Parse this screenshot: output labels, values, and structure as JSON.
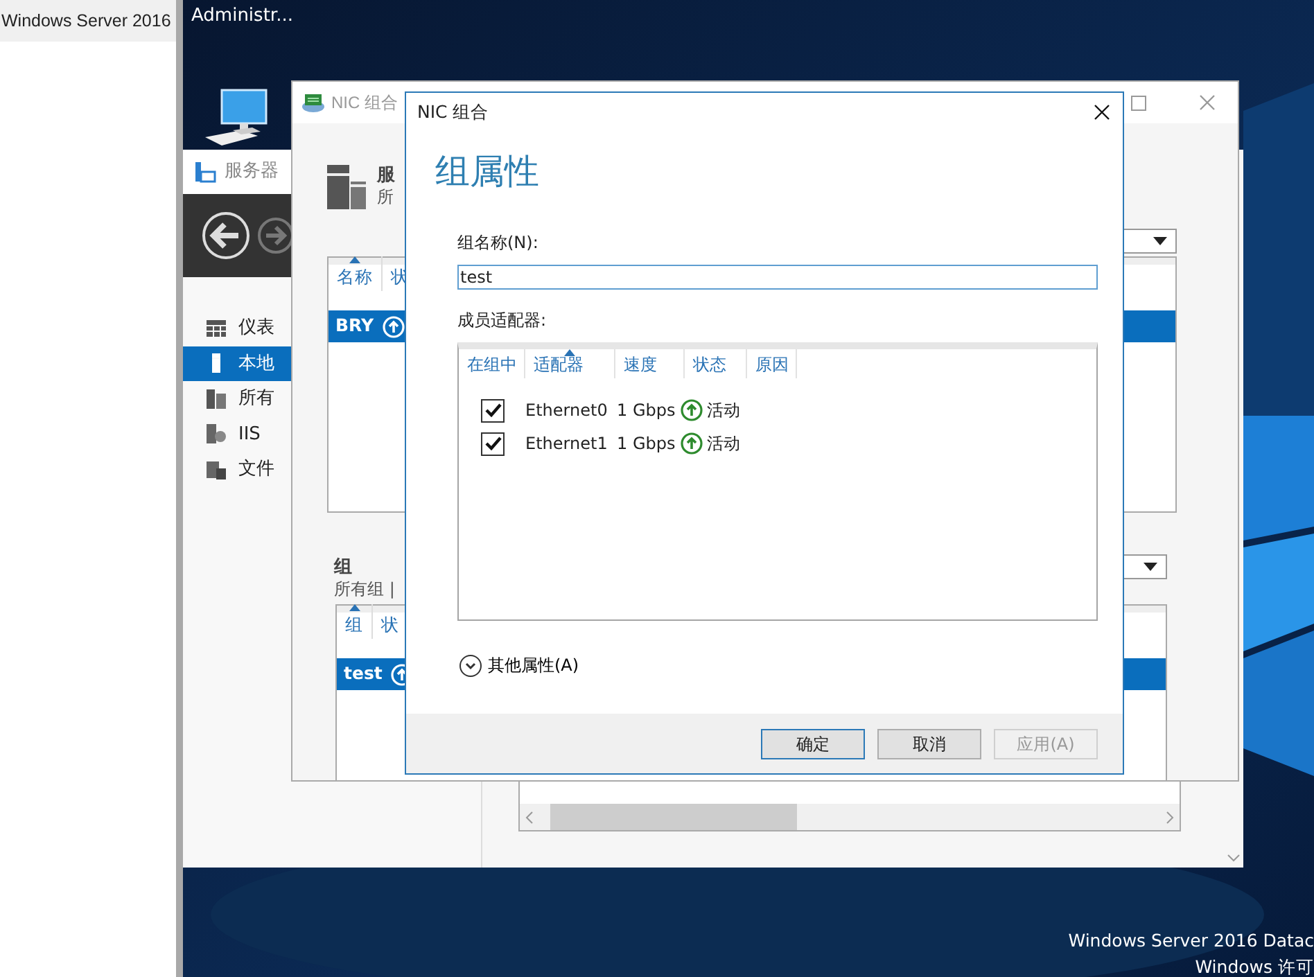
{
  "side_panel": {
    "title": "Windows Server 2016"
  },
  "desktop": {
    "user": "Administr...",
    "edition_lines": [
      "Windows Server 2016 Datac",
      "Windows 许可"
    ]
  },
  "server_manager": {
    "title": "服务器",
    "nav": [
      {
        "label": "仪表",
        "kind": "dashboard",
        "selected": false
      },
      {
        "label": "本地",
        "kind": "server",
        "selected": true
      },
      {
        "label": "所有",
        "kind": "servers",
        "selected": false
      },
      {
        "label": "IIS",
        "kind": "iis",
        "selected": false
      },
      {
        "label": "文件",
        "kind": "files",
        "selected": false
      }
    ]
  },
  "nic_window": {
    "title": "NIC 组合",
    "servers": {
      "title": "服",
      "subtitle": "所",
      "columns": [
        {
          "label": "名称",
          "sorted": true
        },
        {
          "label": "状",
          "sorted": false
        }
      ],
      "rows": [
        {
          "name": "BRY",
          "selected": true
        }
      ]
    },
    "teams": {
      "title": "组",
      "subtitle": "所有组 |",
      "columns": [
        {
          "label": "组",
          "sorted": true
        },
        {
          "label": "状",
          "sorted": false
        }
      ],
      "rows": [
        {
          "name": "test",
          "selected": true
        }
      ]
    }
  },
  "dialog": {
    "title": "NIC 组合",
    "heading": "组属性",
    "name_label": "组名称(N):",
    "name_value": "test",
    "members_label": "成员适配器:",
    "columns": [
      {
        "label": "在组中",
        "sorted": false
      },
      {
        "label": "适配器",
        "sorted": true
      },
      {
        "label": "速度",
        "sorted": false
      },
      {
        "label": "状态",
        "sorted": false
      },
      {
        "label": "原因",
        "sorted": false
      }
    ],
    "adapters": [
      {
        "in_team": true,
        "name": "Ethernet0",
        "speed": "1 Gbps",
        "status": "活动"
      },
      {
        "in_team": true,
        "name": "Ethernet1",
        "speed": "1 Gbps",
        "status": "活动"
      }
    ],
    "expander": {
      "label": "其他属性(A)",
      "expanded": false
    },
    "buttons": [
      {
        "label": "确定",
        "kind": "default"
      },
      {
        "label": "取消",
        "kind": "normal"
      },
      {
        "label": "应用(A)",
        "kind": "disabled"
      }
    ]
  }
}
